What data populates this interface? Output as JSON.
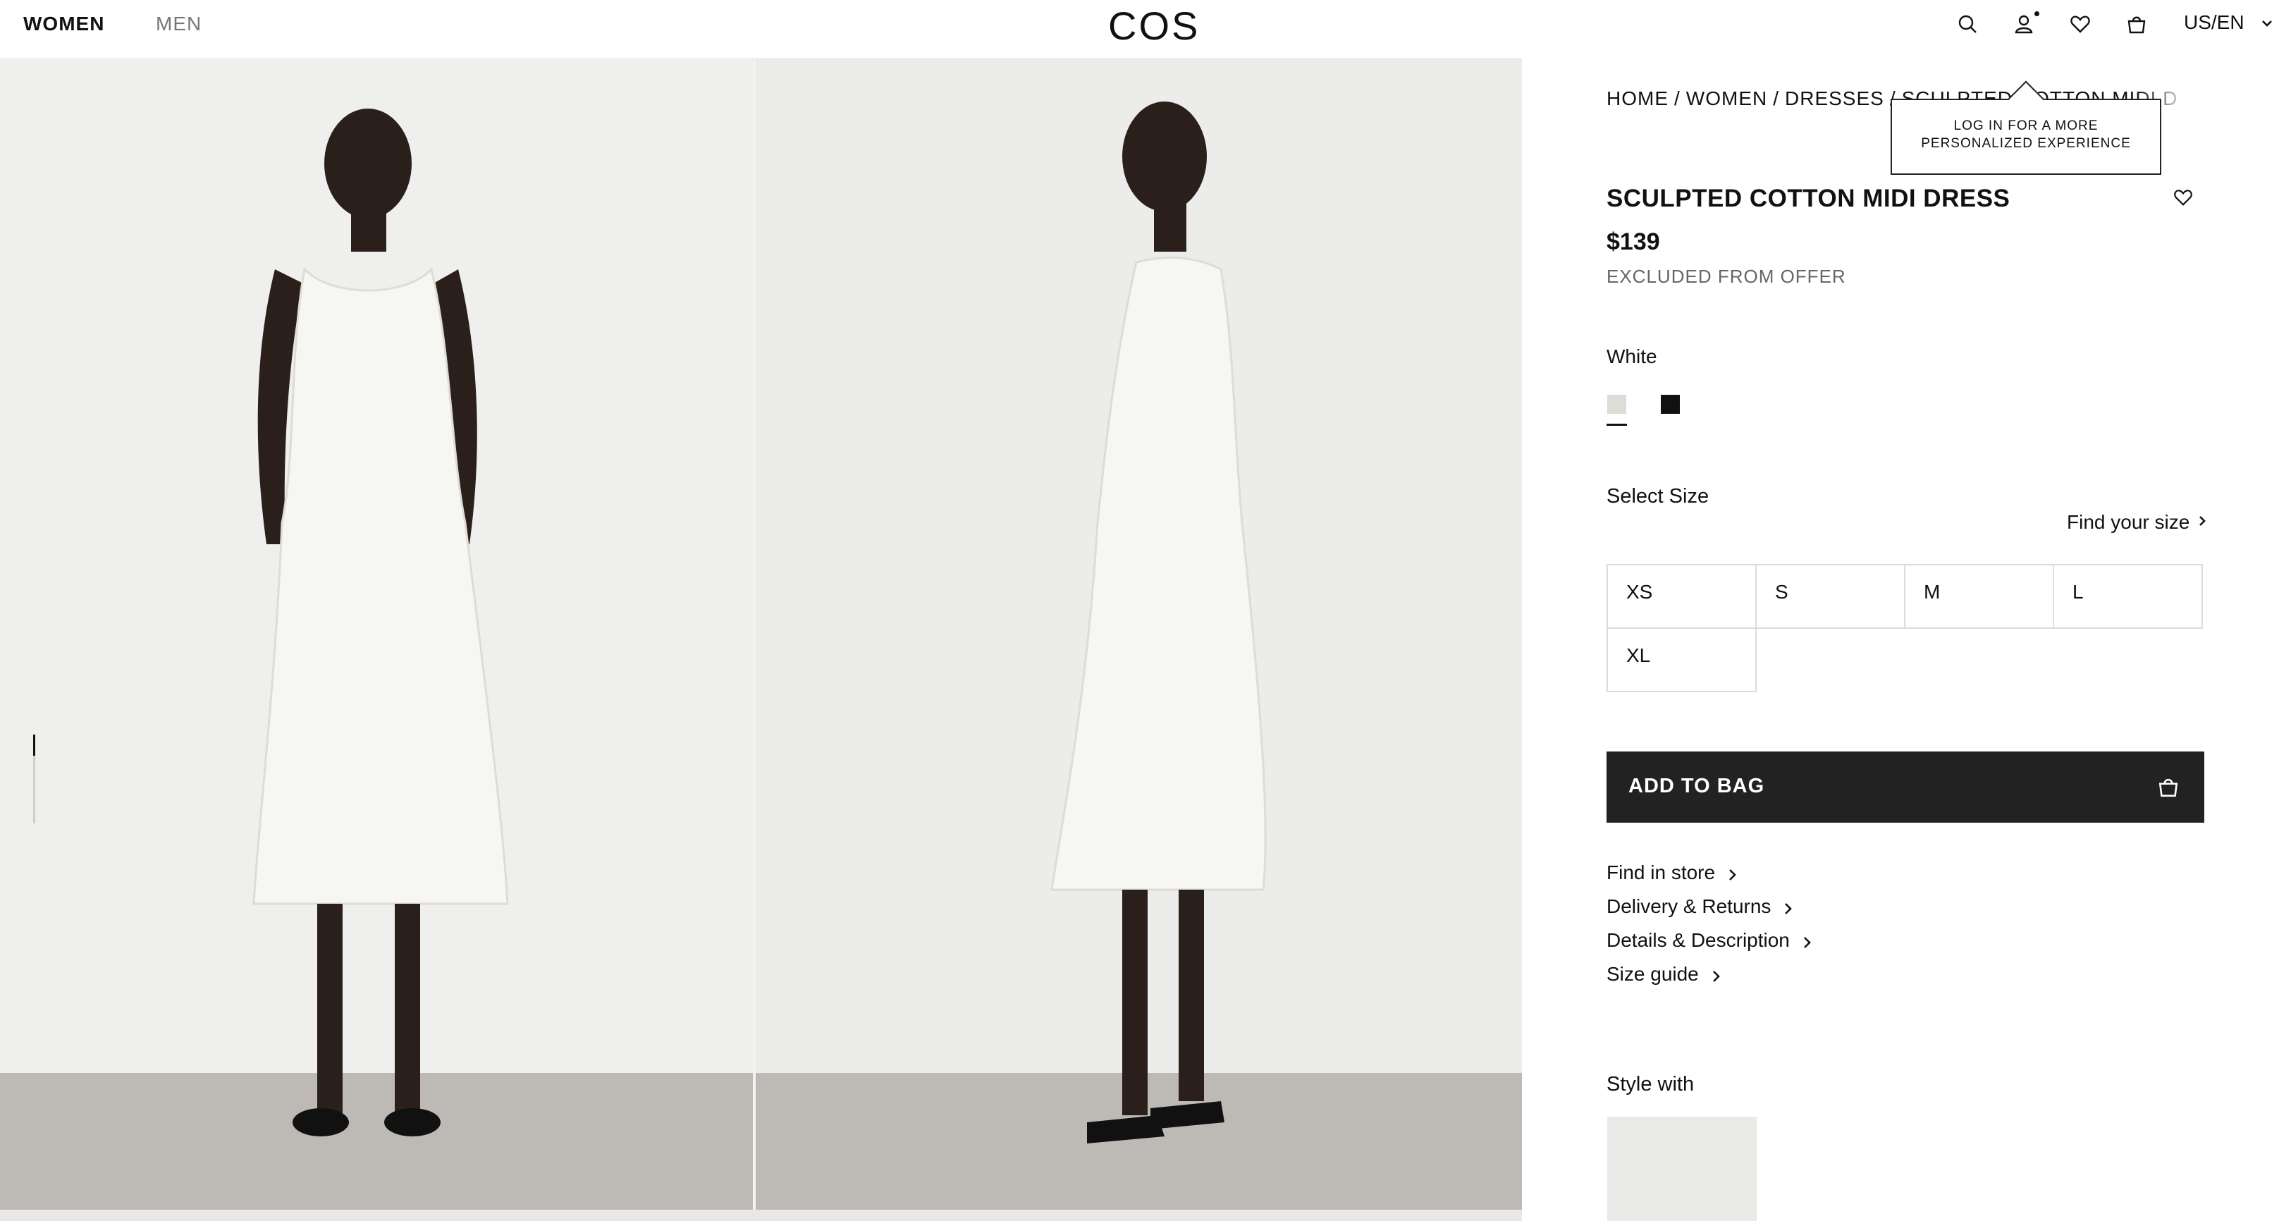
{
  "header": {
    "nav": [
      "WOMEN",
      "MEN"
    ],
    "logo": "COS",
    "locale": "US/EN",
    "icons": [
      "search-icon",
      "account-icon",
      "heart-icon",
      "bag-icon",
      "chevron-down-icon"
    ]
  },
  "gallery": {
    "images": [
      "front-view-photo",
      "side-view-photo"
    ]
  },
  "breadcrumb": [
    "HOME",
    "WOMEN",
    "DRESSES",
    "SCULPTED COTTON MIDI DRESS"
  ],
  "tooltip": {
    "text": "LOG IN FOR A MORE\nPERSONALIZED EXPERIENCE"
  },
  "product": {
    "title": "SCULPTED COTTON MIDI DRESS",
    "price": "$139",
    "offer_note": "EXCLUDED FROM OFFER",
    "color_label": "White",
    "colors": [
      {
        "name": "White",
        "hex": "#dedcd6",
        "selected": true
      },
      {
        "name": "Black",
        "hex": "#111111",
        "selected": false
      }
    ],
    "select_size_label": "Select Size",
    "find_size_label": "Find your size",
    "sizes": [
      "XS",
      "S",
      "M",
      "L",
      "XL"
    ],
    "add_to_bag_label": "ADD TO BAG",
    "links": [
      "Find in store",
      "Delivery & Returns",
      "Details & Description",
      "Size guide"
    ],
    "style_with_label": "Style with"
  },
  "colors": {
    "button_bg": "#222222",
    "text": "#111111",
    "muted": "#666666",
    "border": "#dcdcdc"
  }
}
